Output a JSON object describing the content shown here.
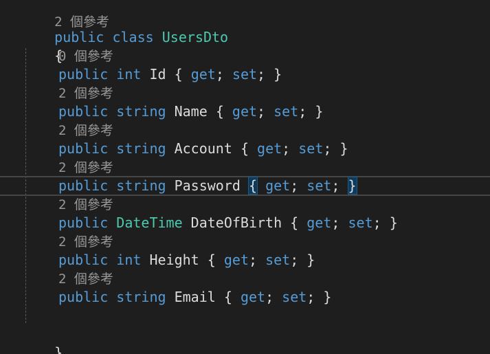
{
  "colors": {
    "background": "#1e1e1e",
    "keyword": "#569cd6",
    "type": "#4ec9b0",
    "identifier": "#dcdcdc",
    "codelens": "#999999",
    "current_line_border": "#464646",
    "brace_match_bg": "#0e3a5c"
  },
  "top_codelens": "2 個參考",
  "class_decl": {
    "kw_public": "public",
    "kw_class": "class",
    "name": "UsersDto"
  },
  "open_brace": "{",
  "close_brace": "}",
  "properties": [
    {
      "codelens": "0 個參考",
      "modifier": "public",
      "type": "int",
      "type_is_class": false,
      "name": "Id",
      "accessor_open": "{",
      "get": "get",
      "set": "set",
      "accessor_close": "}"
    },
    {
      "codelens": "2 個參考",
      "modifier": "public",
      "type": "string",
      "type_is_class": false,
      "name": "Name",
      "accessor_open": "{",
      "get": "get",
      "set": "set",
      "accessor_close": "}"
    },
    {
      "codelens": "2 個參考",
      "modifier": "public",
      "type": "string",
      "type_is_class": false,
      "name": "Account",
      "accessor_open": "{",
      "get": "get",
      "set": "set",
      "accessor_close": "}"
    },
    {
      "codelens": "2 個參考",
      "modifier": "public",
      "type": "string",
      "type_is_class": false,
      "name": "Password",
      "accessor_open": "{",
      "get": "get",
      "set": "set",
      "accessor_close": "}",
      "current": true
    },
    {
      "codelens": "2 個參考",
      "modifier": "public",
      "type": "DateTime",
      "type_is_class": true,
      "name": "DateOfBirth",
      "accessor_open": "{",
      "get": "get",
      "set": "set",
      "accessor_close": "}"
    },
    {
      "codelens": "2 個參考",
      "modifier": "public",
      "type": "int",
      "type_is_class": false,
      "name": "Height",
      "accessor_open": "{",
      "get": "get",
      "set": "set",
      "accessor_close": "}"
    },
    {
      "codelens": "2 個參考",
      "modifier": "public",
      "type": "string",
      "type_is_class": false,
      "name": "Email",
      "accessor_open": "{",
      "get": "get",
      "set": "set",
      "accessor_close": "}"
    }
  ]
}
